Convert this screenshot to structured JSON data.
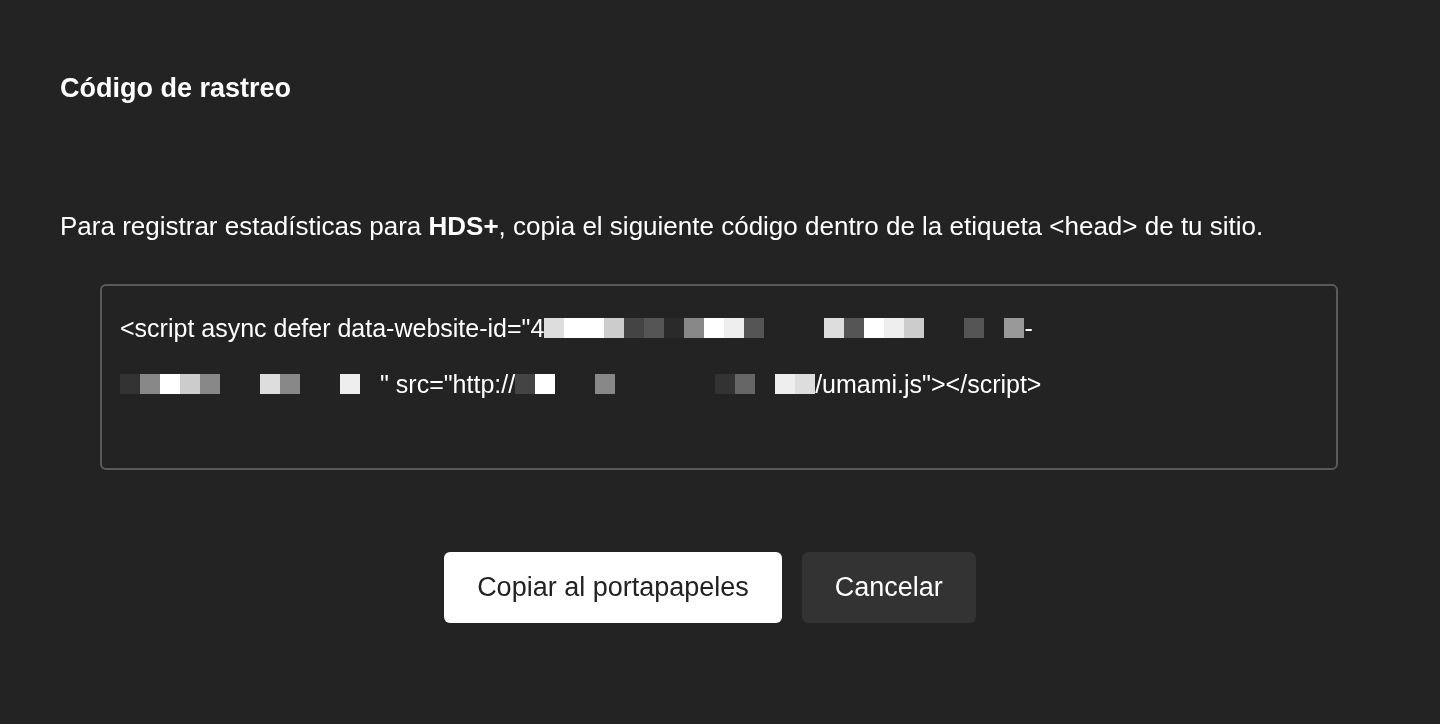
{
  "dialog": {
    "title": "Código de rastreo",
    "description": "Para registrar estadísticas para **HDS+**, copia el siguiente código dentro de la etiqueta <head> de tu sitio.",
    "code_lines": [
      [
        {
          "kind": "text",
          "text": "<script async defer data-website-id=\"4"
        },
        {
          "kind": "redacted"
        },
        {
          "kind": "text",
          "text": "-"
        }
      ],
      [
        {
          "kind": "redacted"
        },
        {
          "kind": "text",
          "text": "\" src=\"http://"
        },
        {
          "kind": "redacted"
        },
        {
          "kind": "text",
          "text": "/umami.js\"></script>"
        }
      ]
    ],
    "buttons": [
      {
        "label": "Copiar al portapapeles",
        "kind": "primary"
      },
      {
        "label": "Cancelar",
        "kind": "secondary"
      }
    ]
  }
}
